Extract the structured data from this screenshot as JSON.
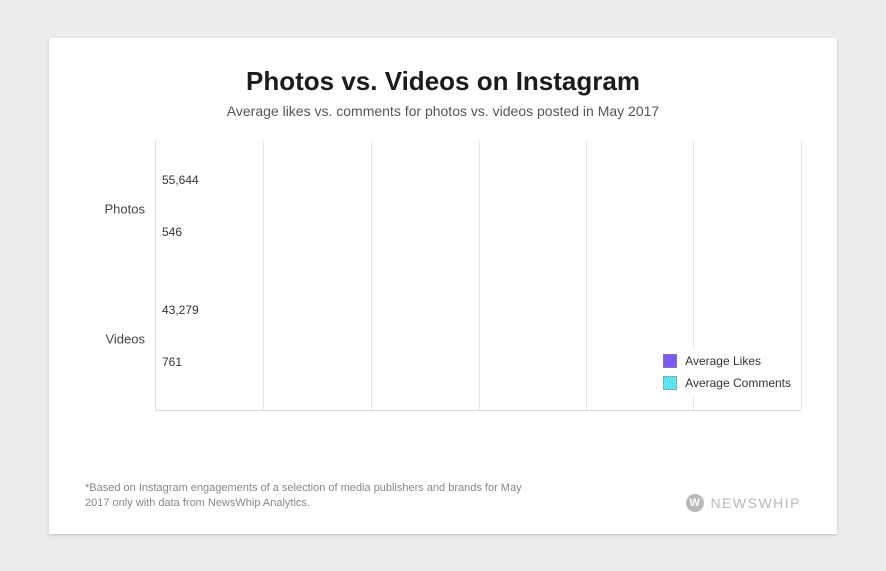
{
  "chart_data": {
    "type": "bar",
    "orientation": "horizontal",
    "title": "Photos vs. Videos on Instagram",
    "subtitle": "Average likes vs. comments for photos vs. videos posted in May 2017",
    "categories": [
      "Photos",
      "Videos"
    ],
    "series": [
      {
        "name": "Average Likes",
        "values": [
          55644,
          43279
        ],
        "color": "#7a5af0"
      },
      {
        "name": "Average Comments",
        "values": [
          546,
          761
        ],
        "color": "#5de4ee"
      }
    ],
    "xlabel": "",
    "ylabel": "",
    "xlim": [
      0,
      60000
    ],
    "grid_ticks": [
      0,
      10000,
      20000,
      30000,
      40000,
      50000,
      60000
    ],
    "legend_position": "bottom-right"
  },
  "value_labels": {
    "photos_likes": "55,644",
    "photos_comments": "546",
    "videos_likes": "43,279",
    "videos_comments": "761"
  },
  "categories": {
    "photos": "Photos",
    "videos": "Videos"
  },
  "legend": {
    "likes": "Average Likes",
    "comments": "Average Comments"
  },
  "footnote": "*Based on Instagram engagements of a selection of media publishers and brands for May 2017 only with data from NewsWhip Analytics.",
  "brand": {
    "name": "NEWSWHIP",
    "icon_letter": "W"
  },
  "colors": {
    "likes": "#7a5af0",
    "comments": "#5de4ee"
  }
}
